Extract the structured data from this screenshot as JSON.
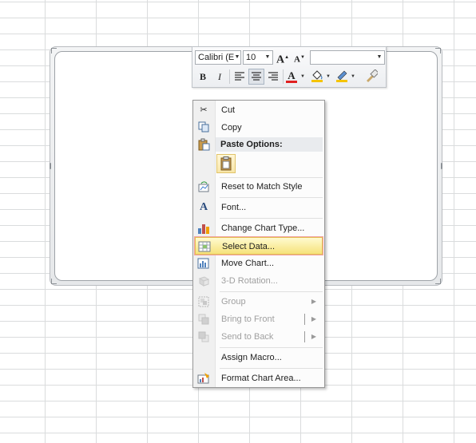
{
  "mini_toolbar": {
    "font_name": "Calibri (E",
    "font_size": "10",
    "grow_font": "A",
    "shrink_font": "A",
    "bold": "B",
    "italic": "I",
    "font_color_letter": "A"
  },
  "context_menu": {
    "items": [
      {
        "label": "Cut",
        "icon": "scissors-icon"
      },
      {
        "label": "Copy",
        "icon": "copy-icon"
      },
      {
        "label": "Paste Options:",
        "icon": "paste-icon"
      },
      {
        "label": "Reset to Match Style",
        "icon": "reset-style-icon"
      },
      {
        "label": "Font...",
        "icon": "font-icon"
      },
      {
        "label": "Change Chart Type...",
        "icon": "chart-type-icon"
      },
      {
        "label": "Select Data...",
        "icon": "select-data-icon"
      },
      {
        "label": "Move Chart...",
        "icon": "move-chart-icon"
      },
      {
        "label": "3-D Rotation...",
        "icon": "rotation-icon"
      },
      {
        "label": "Group",
        "icon": "group-icon"
      },
      {
        "label": "Bring to Front",
        "icon": "bring-front-icon"
      },
      {
        "label": "Send to Back",
        "icon": "send-back-icon"
      },
      {
        "label": "Assign Macro...",
        "icon": "macro-icon"
      },
      {
        "label": "Format Chart Area...",
        "icon": "format-chart-icon"
      }
    ]
  },
  "colors": {
    "highlight_fill": "#f6e27a",
    "highlight_border": "#e2bd53",
    "font_color": "#e02020",
    "fill_color": "#f5c400",
    "line_color": "#f5c400"
  }
}
